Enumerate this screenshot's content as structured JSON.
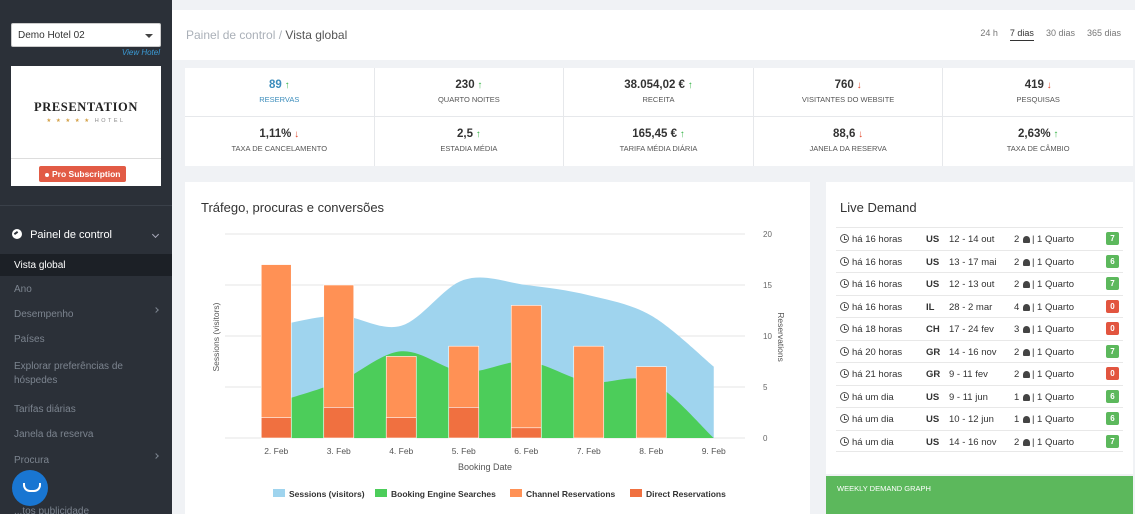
{
  "sidebar": {
    "hotel_select": "Demo Hotel 02",
    "view_hotel": "View Hotel",
    "logo": {
      "title": "PRESENTATION",
      "stars": "★ ★ ★ ★ ★",
      "subtitle": "HOTEL"
    },
    "pro_badge": "Pro Subscription",
    "nav_header": "Painel de control",
    "items": [
      {
        "label": "Vista global",
        "active": true
      },
      {
        "label": "Ano"
      },
      {
        "label": "Desempenho",
        "has_children": true
      },
      {
        "label": "Países"
      },
      {
        "label": "Explorar preferências de hóspedes"
      },
      {
        "label": "Tarifas diárias"
      },
      {
        "label": "Janela da reserva"
      },
      {
        "label": "Procura",
        "has_children": true
      },
      {
        "label": "...a"
      },
      {
        "label": "...tos publicidade"
      }
    ]
  },
  "topbar": {
    "breadcrumb_root": "Painel de control",
    "breadcrumb_sep": " / ",
    "breadcrumb_current": "Vista global",
    "ranges": [
      "24 h",
      "7 dias",
      "30 dias",
      "365 dias"
    ],
    "active_range": "7 dias"
  },
  "kpis": [
    {
      "value": "89",
      "label": "RESERVAS",
      "trend": "up",
      "highlight": true
    },
    {
      "value": "230",
      "label": "QUARTO NOITES",
      "trend": "up"
    },
    {
      "value": "38.054,02 €",
      "label": "RECEITA",
      "trend": "up"
    },
    {
      "value": "760",
      "label": "VISITANTES DO WEBSITE",
      "trend": "down"
    },
    {
      "value": "419",
      "label": "PESQUISAS",
      "trend": "down"
    },
    {
      "value": "1,11%",
      "label": "TAXA DE CANCELAMENTO",
      "trend": "down"
    },
    {
      "value": "2,5",
      "label": "ESTADIA MÉDIA",
      "trend": "up"
    },
    {
      "value": "165,45 €",
      "label": "TARIFA MÉDIA DIÁRIA",
      "trend": "up"
    },
    {
      "value": "88,6",
      "label": "JANELA DA RESERVA",
      "trend": "down"
    },
    {
      "value": "2,63%",
      "label": "TAXA DE CÂMBIO",
      "trend": "up"
    }
  ],
  "chart_panel": {
    "title": "Tráfego, procuras e conversões"
  },
  "chart_data": {
    "type": "bar",
    "categories": [
      "2. Feb",
      "3. Feb",
      "4. Feb",
      "5. Feb",
      "6. Feb",
      "7. Feb",
      "8. Feb",
      "9. Feb"
    ],
    "xlabel": "Booking Date",
    "ylabel_left": "Sessions (visitors)",
    "ylabel_right": "Reservations",
    "right_ticks": [
      0,
      5,
      10,
      15,
      20
    ],
    "ylim_right": [
      0,
      20
    ],
    "series": [
      {
        "name": "Sessions (visitors)",
        "type": "area",
        "color": "#9fd4ee",
        "values": [
          11,
          12,
          11,
          15.5,
          15,
          14,
          12,
          7
        ]
      },
      {
        "name": "Booking Engine Searches",
        "type": "area",
        "color": "#4ccd5a",
        "values": [
          3.5,
          5.5,
          8.5,
          6.5,
          7.5,
          5.5,
          5.5,
          0
        ]
      },
      {
        "name": "Channel Reservations",
        "type": "bar",
        "color": "#ff9155",
        "values": [
          17,
          15,
          8,
          9,
          13,
          9,
          7,
          0
        ]
      },
      {
        "name": "Direct Reservations",
        "type": "bar",
        "color": "#f07040",
        "values": [
          2,
          3,
          2,
          3,
          1,
          0,
          0,
          0
        ]
      }
    ],
    "legend_position": "bottom"
  },
  "live_demand": {
    "title": "Live Demand",
    "rows": [
      {
        "time": "há 16 horas",
        "cc": "US",
        "dates": "12 - 14 out",
        "guests": "2",
        "room": "| 1 Quarto",
        "score": "7",
        "score_color": "#5cb85c"
      },
      {
        "time": "há 16 horas",
        "cc": "US",
        "dates": "13 - 17 mai",
        "guests": "2",
        "room": "| 1 Quarto",
        "score": "6",
        "score_color": "#5cb85c"
      },
      {
        "time": "há 16 horas",
        "cc": "US",
        "dates": "12 - 13 out",
        "guests": "2",
        "room": "| 1 Quarto",
        "score": "7",
        "score_color": "#5cb85c"
      },
      {
        "time": "há 16 horas",
        "cc": "IL",
        "dates": "28 - 2 mar",
        "guests": "4",
        "room": "| 1 Quarto",
        "score": "0",
        "score_color": "#e2553f"
      },
      {
        "time": "há 18 horas",
        "cc": "CH",
        "dates": "17 - 24 fev",
        "guests": "3",
        "room": "| 1 Quarto",
        "score": "0",
        "score_color": "#e2553f"
      },
      {
        "time": "há 20 horas",
        "cc": "GR",
        "dates": "14 - 16 nov",
        "guests": "2",
        "room": "| 1 Quarto",
        "score": "7",
        "score_color": "#5cb85c"
      },
      {
        "time": "há 21 horas",
        "cc": "GR",
        "dates": "9 - 11 fev",
        "guests": "2",
        "room": "| 1 Quarto",
        "score": "0",
        "score_color": "#e2553f"
      },
      {
        "time": "há um dia",
        "cc": "US",
        "dates": "9 - 11 jun",
        "guests": "1",
        "room": "| 1 Quarto",
        "score": "6",
        "score_color": "#5cb85c"
      },
      {
        "time": "há um dia",
        "cc": "US",
        "dates": "10 - 12 jun",
        "guests": "1",
        "room": "| 1 Quarto",
        "score": "6",
        "score_color": "#5cb85c"
      },
      {
        "time": "há um dia",
        "cc": "US",
        "dates": "14 - 16 nov",
        "guests": "2",
        "room": "| 1 Quarto",
        "score": "7",
        "score_color": "#5cb85c"
      }
    ]
  },
  "weekly_graph": {
    "label": "WEEKLY DEMAND GRAPH"
  }
}
